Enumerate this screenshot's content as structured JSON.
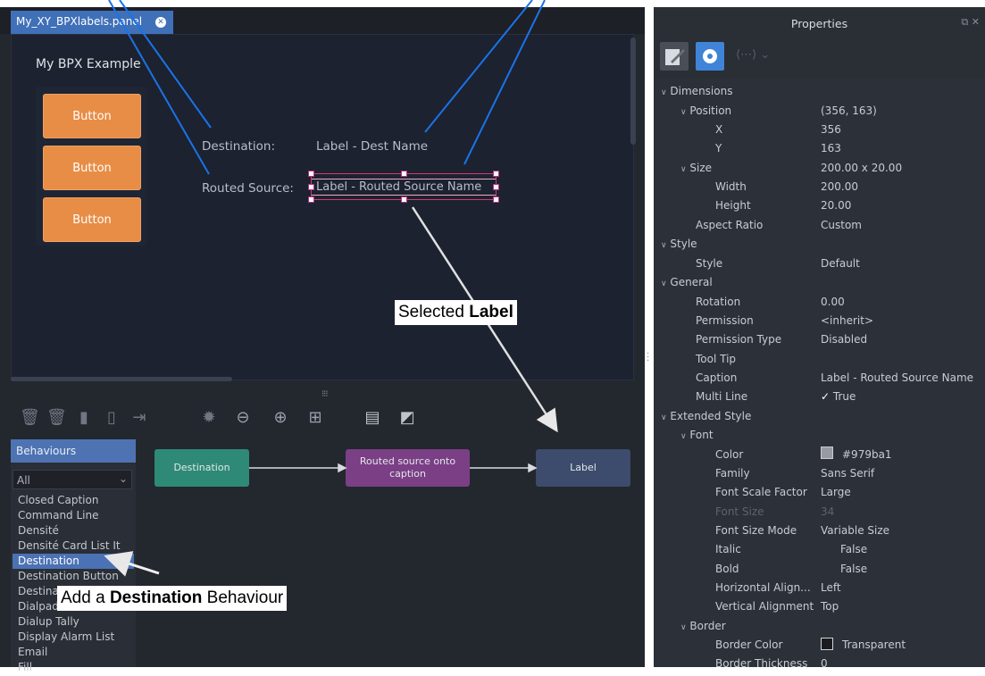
{
  "tab": {
    "title": "My_XY_BPXlabels.panel"
  },
  "canvas": {
    "panel_title": "My BPX Example",
    "buttons": [
      "Button",
      "Button",
      "Button"
    ],
    "destination_label": "Destination:",
    "destination_value": "Label - Dest Name",
    "routed_label": "Routed Source:",
    "routed_value": "Label - Routed Source Name"
  },
  "callouts": {
    "selected_pre": "Selected ",
    "selected_bold": "Label",
    "add_pre": "Add a ",
    "add_bold": "Destination",
    "add_post": " Behaviour"
  },
  "behaviours": {
    "header": "Behaviours",
    "filter": "All",
    "items": [
      "Closed Caption",
      "Command Line",
      "Densité",
      "Densité Card List It",
      "Destination",
      "Destination Button",
      "Destination List",
      "Dialpad",
      "Dialup Tally",
      "Display Alarm List",
      "Email",
      "Fill"
    ],
    "selected": "Destination"
  },
  "graph": {
    "nodes": [
      {
        "label": "Destination",
        "color": "#2e8a76"
      },
      {
        "label": "Routed source onto caption",
        "color": "#7b3f86"
      },
      {
        "label": "Label",
        "color": "#3d4b6c"
      }
    ]
  },
  "properties": {
    "title": "Properties",
    "sections": {
      "dimensions": "Dimensions",
      "position_label": "Position",
      "position_value": "(356, 163)",
      "x_label": "X",
      "x_value": "356",
      "y_label": "Y",
      "y_value": "163",
      "size_label": "Size",
      "size_value": "200.00 x 20.00",
      "width_label": "Width",
      "width_value": "200.00",
      "height_label": "Height",
      "height_value": "20.00",
      "aspect_label": "Aspect Ratio",
      "aspect_value": "Custom",
      "style_section": "Style",
      "style_label": "Style",
      "style_value": "Default",
      "general_section": "General",
      "rotation_label": "Rotation",
      "rotation_value": "0.00",
      "permission_label": "Permission",
      "permission_value": "<inherit>",
      "permtype_label": "Permission Type",
      "permtype_value": "Disabled",
      "tooltip_label": "Tool Tip",
      "tooltip_value": "",
      "caption_label": "Caption",
      "caption_value": "Label - Routed Source Name",
      "multiline_label": "Multi Line",
      "multiline_value": "True",
      "extstyle_section": "Extended Style",
      "font_section": "Font",
      "color_label": "Color",
      "color_value": "#979ba1",
      "family_label": "Family",
      "family_value": "Sans Serif",
      "scale_label": "Font Scale Factor",
      "scale_value": "Large",
      "fontsize_label": "Font Size",
      "fontsize_value": "34",
      "sizemode_label": "Font Size Mode",
      "sizemode_value": "Variable Size",
      "italic_label": "Italic",
      "italic_value": "False",
      "bold_label": "Bold",
      "bold_value": "False",
      "halign_label": "Horizontal Align...",
      "halign_value": "Left",
      "valign_label": "Vertical Alignment",
      "valign_value": "Top",
      "border_section": "Border",
      "bordercolor_label": "Border Color",
      "bordercolor_value": "Transparent",
      "borderthick_label": "Border Thickness",
      "borderthick_value": "0"
    }
  },
  "colors": {
    "accent": "#4b72b4",
    "button": "#e88d46",
    "selection": "#d43a6a"
  }
}
